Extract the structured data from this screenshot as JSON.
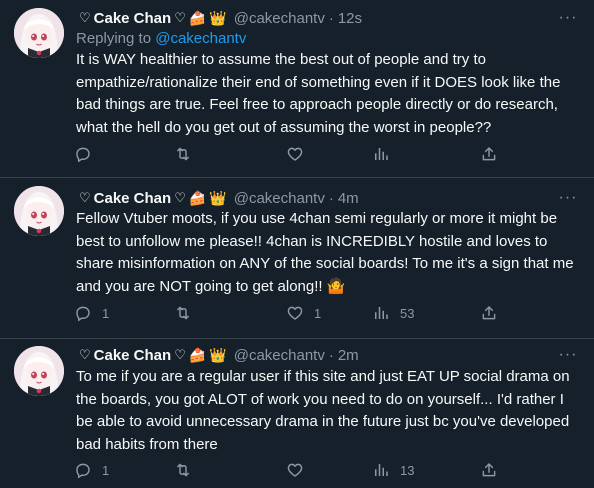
{
  "colors": {
    "background": "#15202b",
    "text": "#f7f9f9",
    "muted": "#8b98a5",
    "link": "#1d9bf0",
    "divider": "#38444d"
  },
  "tweets": [
    {
      "name": "Cake Chan",
      "name_decor_left": "♡",
      "name_decor_right": "♡",
      "emoji_cake": "🍰",
      "emoji_crown": "👑",
      "handle": "@cakechantv",
      "sep": "·",
      "time": "12s",
      "more": "···",
      "replying_prefix": "Replying to ",
      "replying_to": "@cakechantv",
      "text": "It is WAY healthier to assume the best out of people and try to empathize/rationalize their end of something even if it DOES look like the bad things are true. Feel free to approach people directly or do research, what the hell do you get out of assuming the worst in people??",
      "reply_count": "",
      "retweet_count": "",
      "like_count": "",
      "view_count": ""
    },
    {
      "name": "Cake Chan",
      "name_decor_left": "♡",
      "name_decor_right": "♡",
      "emoji_cake": "🍰",
      "emoji_crown": "👑",
      "handle": "@cakechantv",
      "sep": "·",
      "time": "4m",
      "more": "···",
      "text": "Fellow Vtuber moots, if you use 4chan semi regularly or more it might be best to unfollow me please!! 4chan is INCREDIBLY hostile and loves to share misinformation on ANY of the social boards! To me it's a sign that me and you are NOT going to get along!! 🤷",
      "reply_count": "1",
      "retweet_count": "",
      "like_count": "1",
      "view_count": "53"
    },
    {
      "name": "Cake Chan",
      "name_decor_left": "♡",
      "name_decor_right": "♡",
      "emoji_cake": "🍰",
      "emoji_crown": "👑",
      "handle": "@cakechantv",
      "sep": "·",
      "time": "2m",
      "more": "···",
      "text": "To me if you are a regular user if this site and just EAT UP social drama on the boards, you got ALOT of work you need to do on yourself... I'd rather I be able to avoid unnecessary drama in the future just bc you've developed bad habits from there",
      "reply_count": "1",
      "retweet_count": "",
      "like_count": "",
      "view_count": "13"
    }
  ]
}
